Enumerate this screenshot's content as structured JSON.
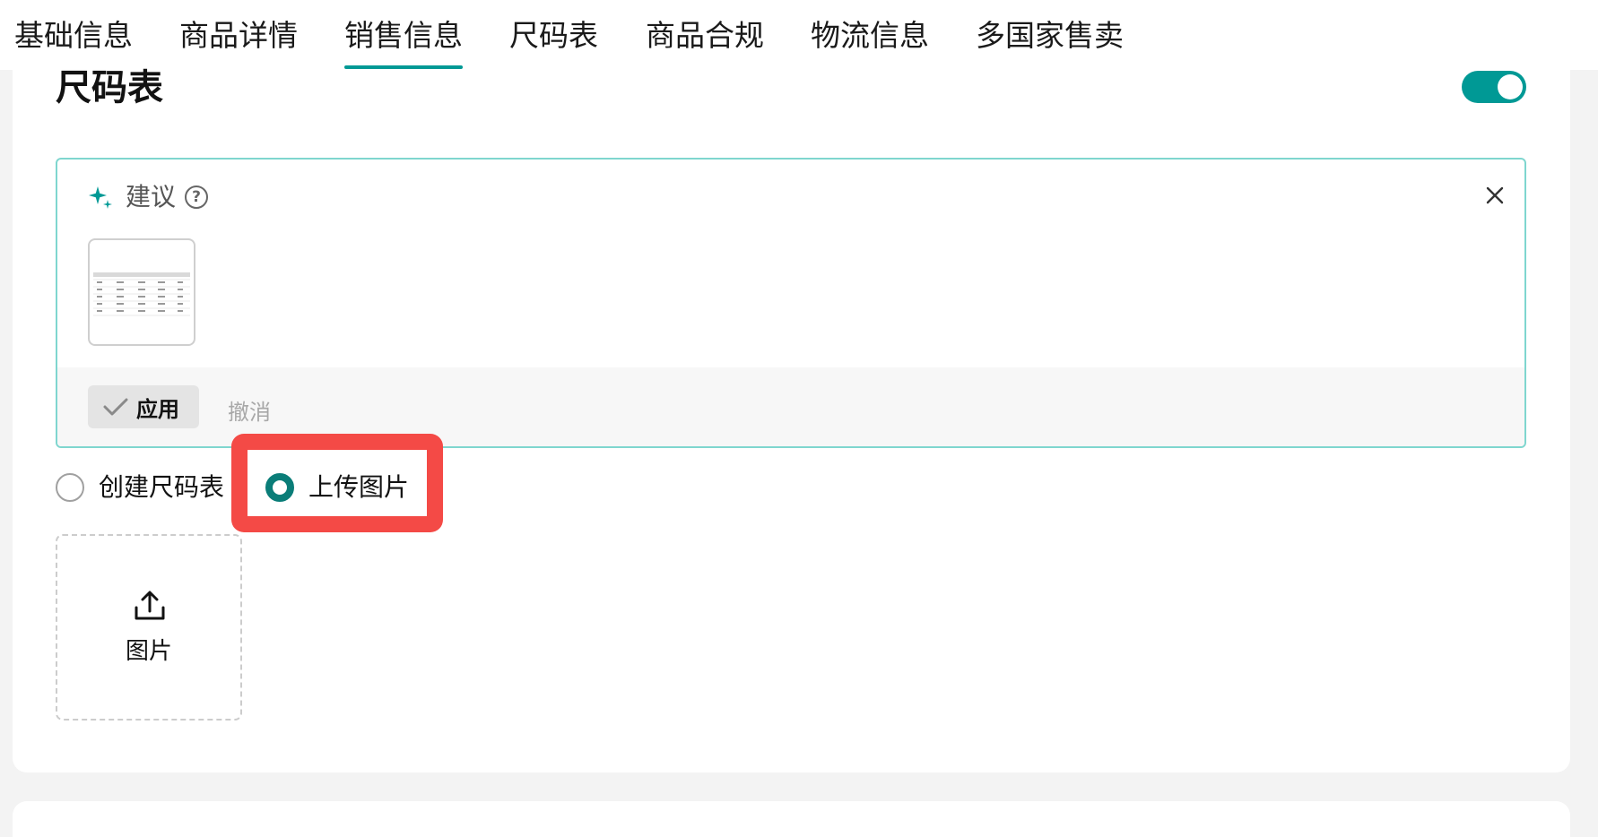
{
  "tabs": [
    {
      "label": "基础信息"
    },
    {
      "label": "商品详情"
    },
    {
      "label": "销售信息",
      "active": true
    },
    {
      "label": "尺码表"
    },
    {
      "label": "商品合规"
    },
    {
      "label": "物流信息"
    },
    {
      "label": "多国家售卖"
    }
  ],
  "section": {
    "title": "尺码表",
    "toggle_on": true
  },
  "suggestion": {
    "title": "建议",
    "help_symbol": "?",
    "apply_label": "应用",
    "cancel_label": "撤消",
    "thumbnail_icon": "size-chart-image"
  },
  "options": [
    {
      "label": "创建尺码表",
      "checked": false
    },
    {
      "label": "上传图片",
      "checked": true
    }
  ],
  "upload": {
    "label": "图片",
    "icon": "upload-icon"
  },
  "colors": {
    "accent": "#009995",
    "radio_checked": "#0a7d78",
    "highlight": "#f44a46",
    "suggest_border": "#7fd6cf"
  }
}
